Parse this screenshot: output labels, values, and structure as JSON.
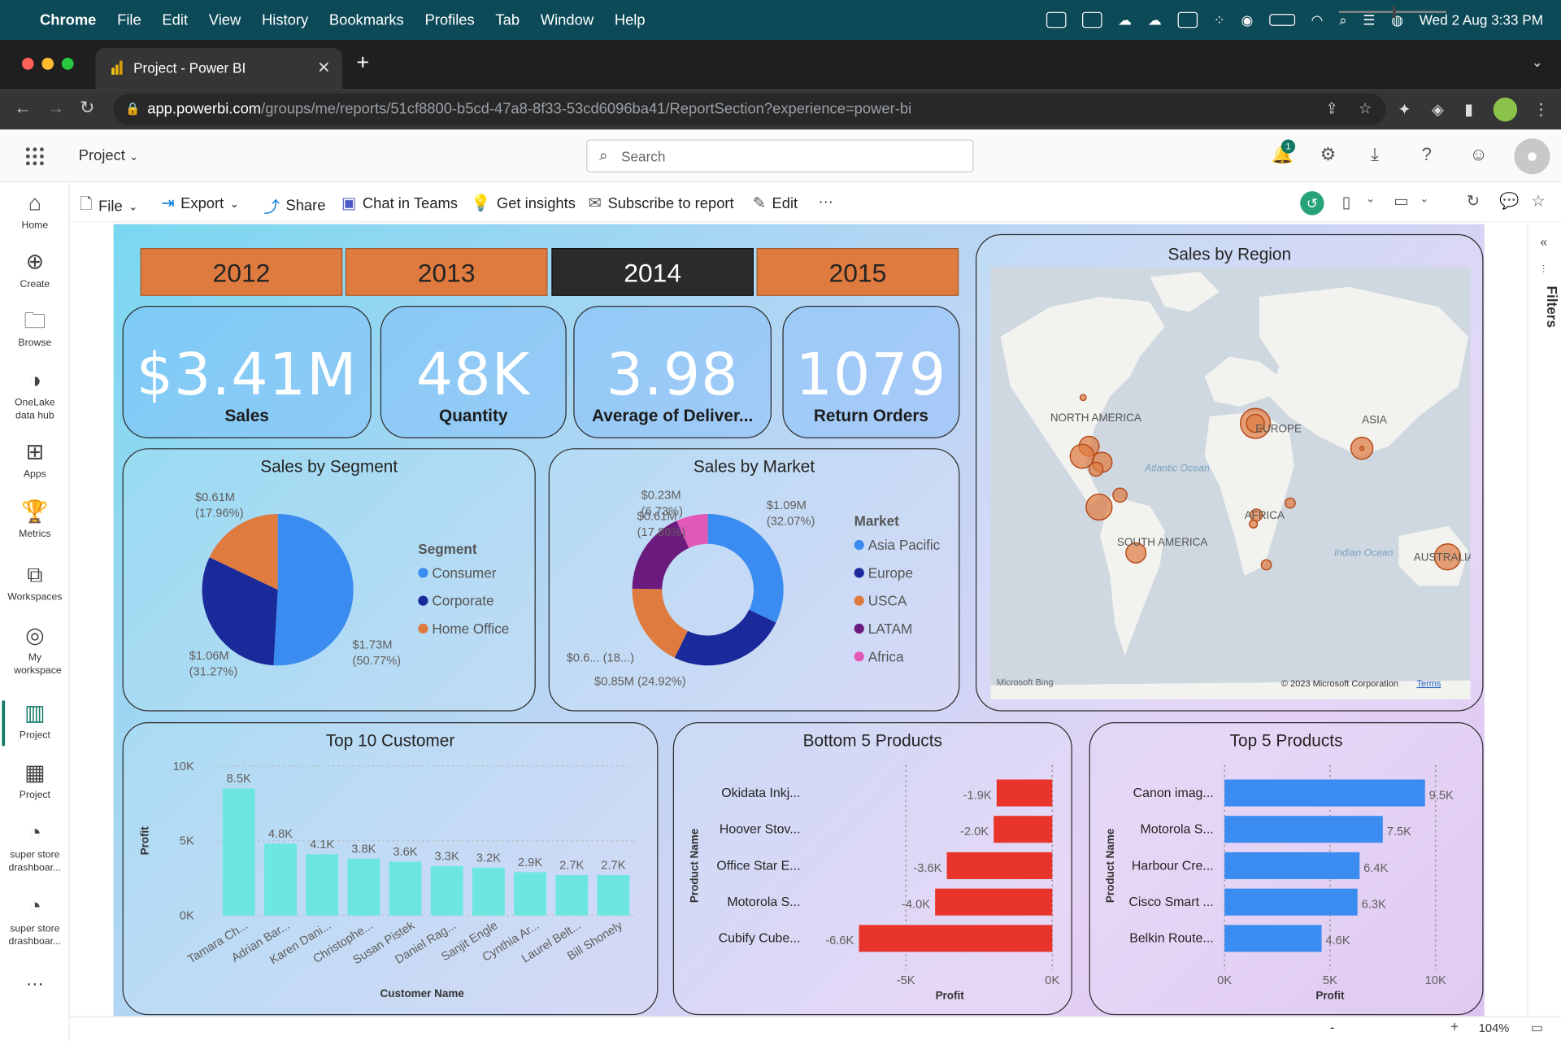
{
  "menubar": {
    "app": "Chrome",
    "items": [
      "File",
      "Edit",
      "View",
      "History",
      "Bookmarks",
      "Profiles",
      "Tab",
      "Window",
      "Help"
    ],
    "datetime": "Wed 2 Aug  3:33 PM"
  },
  "browser": {
    "tab_title": "Project - Power BI",
    "url_host": "app.powerbi.com",
    "url_path": "/groups/me/reports/51cf8800-b5cd-47a8-8f33-53cd6096ba41/ReportSection?experience=power-bi"
  },
  "header": {
    "workspace": "Project",
    "search_placeholder": "Search",
    "notification_count": "1"
  },
  "toolbar": {
    "file": "File",
    "export": "Export",
    "share": "Share",
    "chat": "Chat in Teams",
    "insights": "Get insights",
    "subscribe": "Subscribe to report",
    "edit": "Edit",
    "more": "···"
  },
  "nav": [
    {
      "label": "Home",
      "icon": "home-icon"
    },
    {
      "label": "Create",
      "icon": "plus-circle-icon"
    },
    {
      "label": "Browse",
      "icon": "folder-icon"
    },
    {
      "label": "OneLake data hub",
      "icon": "onelake-icon"
    },
    {
      "label": "Apps",
      "icon": "apps-icon"
    },
    {
      "label": "Metrics",
      "icon": "trophy-icon"
    },
    {
      "label": "Workspaces",
      "icon": "workspaces-icon"
    },
    {
      "label": "My workspace",
      "icon": "person-icon"
    },
    {
      "label": "Project",
      "icon": "report-icon"
    },
    {
      "label": "Project",
      "icon": "dashboard-icon"
    },
    {
      "label": "super store drashboar...",
      "icon": "gauge-icon"
    },
    {
      "label": "super store drashboar...",
      "icon": "gauge-icon"
    }
  ],
  "filters_label": "Filters",
  "zoom": "104%",
  "years": [
    "2012",
    "2013",
    "2014",
    "2015"
  ],
  "selected_year": "2014",
  "kpis": [
    {
      "value": "$3.41M",
      "label": "Sales"
    },
    {
      "value": "48K",
      "label": "Quantity"
    },
    {
      "value": "3.98",
      "label": "Average of Deliver..."
    },
    {
      "value": "1079",
      "label": "Return Orders"
    }
  ],
  "colors": {
    "orange": "#e07b3f",
    "blue": "#3b8cf0",
    "navy": "#1a2a9a",
    "purple": "#6b1a7d",
    "pink": "#e059b8",
    "teal": "#6ee6e0",
    "red": "#e8342a"
  },
  "chart_data": [
    {
      "type": "pie",
      "title": "Sales by Segment",
      "legend_title": "Segment",
      "categories": [
        "Consumer",
        "Corporate",
        "Home Office"
      ],
      "values": [
        1.73,
        1.06,
        0.61
      ],
      "value_labels": [
        "$1.73M",
        "$1.06M",
        "$0.61M"
      ],
      "percent_labels": [
        "(50.77%)",
        "(31.27%)",
        "(17.96%)"
      ],
      "colors": [
        "#3b8cf0",
        "#1a2a9a",
        "#e07b3f"
      ]
    },
    {
      "type": "pie",
      "variant": "donut",
      "title": "Sales by Market",
      "legend_title": "Market",
      "categories": [
        "Asia Pacific",
        "Europe",
        "USCA",
        "LATAM",
        "Africa"
      ],
      "values": [
        1.09,
        0.85,
        0.61,
        0.61,
        0.23
      ],
      "value_labels": [
        "$1.09M",
        "$0.85M (24.92%)",
        "$0.6... (18...)",
        "$0.61M",
        "$0.23M"
      ],
      "percent_labels": [
        "(32.07%)",
        "",
        "",
        "(17.86%)",
        "(6.73%)"
      ],
      "colors": [
        "#3b8cf0",
        "#1a2a9a",
        "#e07b3f",
        "#6b1a7d",
        "#e059b8"
      ]
    },
    {
      "type": "bar",
      "title": "Top 10 Customer",
      "xlabel": "Customer Name",
      "ylabel": "Profit",
      "categories": [
        "Tamara Ch...",
        "Adrian Bar...",
        "Karen Dani...",
        "Christophe...",
        "Susan Pistek",
        "Daniel Rag...",
        "Sanjit Engle",
        "Cynthia Ar...",
        "Laurel Belt...",
        "Bill Shonely"
      ],
      "values": [
        8500,
        4800,
        4100,
        3800,
        3600,
        3300,
        3200,
        2900,
        2700,
        2700
      ],
      "data_labels": [
        "8.5K",
        "4.8K",
        "4.1K",
        "3.8K",
        "3.6K",
        "3.3K",
        "3.2K",
        "2.9K",
        "2.7K",
        "2.7K"
      ],
      "ylim": [
        0,
        10000
      ],
      "yticks": [
        "0K",
        "5K",
        "10K"
      ]
    },
    {
      "type": "bar",
      "orientation": "horizontal",
      "title": "Bottom 5 Products",
      "xlabel": "Profit",
      "ylabel": "Product Name",
      "categories": [
        "Okidata Inkj...",
        "Hoover Stov...",
        "Office Star E...",
        "Motorola S...",
        "Cubify Cube..."
      ],
      "values": [
        -1900,
        -2000,
        -3600,
        -4000,
        -6600
      ],
      "data_labels": [
        "-1.9K",
        "-2.0K",
        "-3.6K",
        "-4.0K",
        "-6.6K"
      ],
      "xlim": [
        -7000,
        0
      ],
      "xticks": [
        "-5K",
        "0K"
      ]
    },
    {
      "type": "bar",
      "orientation": "horizontal",
      "title": "Top 5 Products",
      "xlabel": "Profit",
      "ylabel": "Product Name",
      "categories": [
        "Canon imag...",
        "Motorola S...",
        "Harbour Cre...",
        "Cisco Smart ...",
        "Belkin Route..."
      ],
      "values": [
        9500,
        7500,
        6400,
        6300,
        4600
      ],
      "data_labels": [
        "9.5K",
        "7.5K",
        "6.4K",
        "6.3K",
        "4.6K"
      ],
      "xlim": [
        0,
        10000
      ],
      "xticks": [
        "0K",
        "5K",
        "10K"
      ]
    }
  ],
  "map": {
    "title": "Sales by Region",
    "labels": [
      "NORTH AMERICA",
      "SOUTH AMERICA",
      "EUROPE",
      "ASIA",
      "AFRICA",
      "AUSTRALIA"
    ],
    "ocean_labels": [
      "Atlantic Ocean",
      "Indian Ocean"
    ],
    "attribution": "Microsoft Bing",
    "copyright": "© 2023 Microsoft Corporation",
    "terms": "Terms"
  }
}
